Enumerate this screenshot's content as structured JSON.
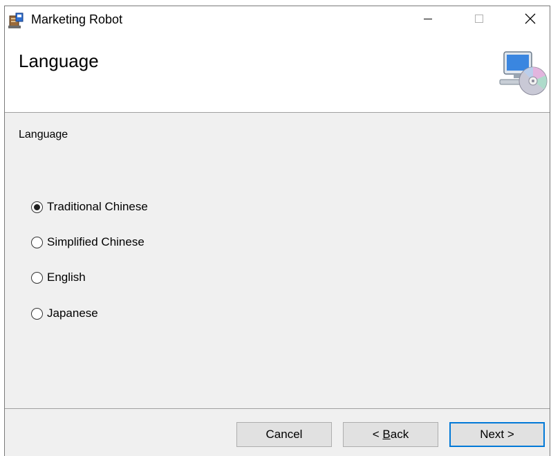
{
  "window": {
    "title": "Marketing Robot"
  },
  "header": {
    "title": "Language"
  },
  "content": {
    "section_label": "Language",
    "options": [
      {
        "label": "Traditional Chinese",
        "selected": true
      },
      {
        "label": "Simplified Chinese",
        "selected": false
      },
      {
        "label": "English",
        "selected": false
      },
      {
        "label": "Japanese",
        "selected": false
      }
    ]
  },
  "footer": {
    "cancel_label": "Cancel",
    "back_mnemonic": "B",
    "back_rest": "ack",
    "next_label": "Next >"
  },
  "icons": {
    "app": "installer-icon",
    "header": "computer-disc-icon",
    "minimize": "minimize-icon",
    "maximize": "maximize-icon",
    "close": "close-icon"
  },
  "colors": {
    "accent": "#0078d7",
    "dialog_bg": "#f0f0f0",
    "button_bg": "#e1e1e1"
  }
}
